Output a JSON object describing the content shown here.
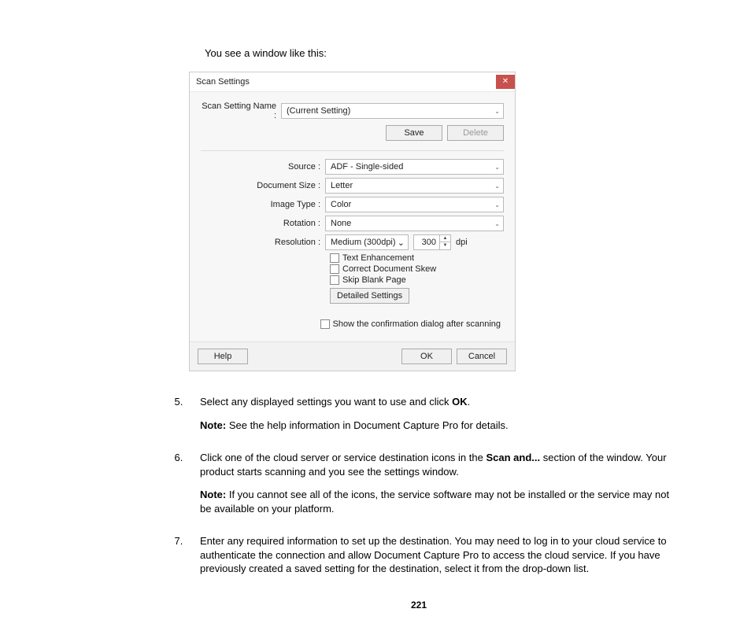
{
  "intro": "You see a window like this:",
  "dialog": {
    "title": "Scan Settings",
    "name_label": "Scan Setting Name :",
    "name_value": "(Current Setting)",
    "save": "Save",
    "delete": "Delete",
    "source_label": "Source :",
    "source_value": "ADF - Single-sided",
    "docsize_label": "Document Size :",
    "docsize_value": "Letter",
    "imagetype_label": "Image Type :",
    "imagetype_value": "Color",
    "rotation_label": "Rotation :",
    "rotation_value": "None",
    "resolution_label": "Resolution :",
    "resolution_value": "Medium (300dpi)",
    "dpi_value": "300",
    "dpi_unit": "dpi",
    "check_text_enh": "Text Enhancement",
    "check_skew": "Correct Document Skew",
    "check_blank": "Skip Blank Page",
    "detailed": "Detailed Settings",
    "confirm": "Show the confirmation dialog after scanning",
    "help": "Help",
    "ok": "OK",
    "cancel": "Cancel"
  },
  "steps": {
    "s5a": "Select any displayed settings you want to use and click ",
    "s5b": "OK",
    "s5c": ".",
    "s5_note_prefix": "Note:",
    "s5_note": " See the help information in Document Capture Pro for details.",
    "s6a": "Click one of the cloud server or service destination icons in the ",
    "s6b": "Scan and...",
    "s6c": " section of the window. Your product starts scanning and you see the settings window.",
    "s6_note_prefix": "Note:",
    "s6_note": " If you cannot see all of the icons, the service software may not be installed or the service may not be available on your platform.",
    "s7": "Enter any required information to set up the destination. You may need to log in to your cloud service to authenticate the connection and allow Document Capture Pro to access the cloud service. If you have previously created a saved setting for the destination, select it from the drop-down list."
  },
  "page_number": "221"
}
